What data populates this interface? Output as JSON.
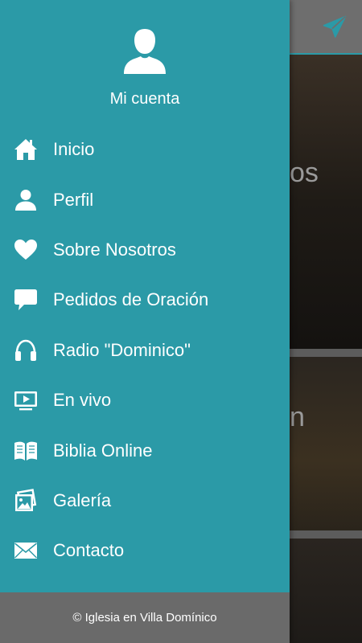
{
  "background": {
    "card_texts": [
      "os",
      "n"
    ]
  },
  "drawer": {
    "account_label": "Mi cuenta",
    "items": [
      {
        "label": "Inicio",
        "icon": "home-icon"
      },
      {
        "label": "Perfil",
        "icon": "person-icon"
      },
      {
        "label": "Sobre Nosotros",
        "icon": "heart-icon"
      },
      {
        "label": "Pedidos de Oración",
        "icon": "chat-bubble-icon"
      },
      {
        "label": "Radio \"Dominico\"",
        "icon": "headphones-icon"
      },
      {
        "label": "En vivo",
        "icon": "tv-play-icon"
      },
      {
        "label": "Biblia Online",
        "icon": "book-icon"
      },
      {
        "label": "Galería",
        "icon": "gallery-icon"
      },
      {
        "label": "Contacto",
        "icon": "envelope-icon"
      }
    ],
    "footer_text": "© Iglesia en Villa Domínico"
  },
  "colors": {
    "drawer_bg": "#2b9aa7",
    "footer_bg": "#6a6a6a",
    "text": "#ffffff"
  }
}
